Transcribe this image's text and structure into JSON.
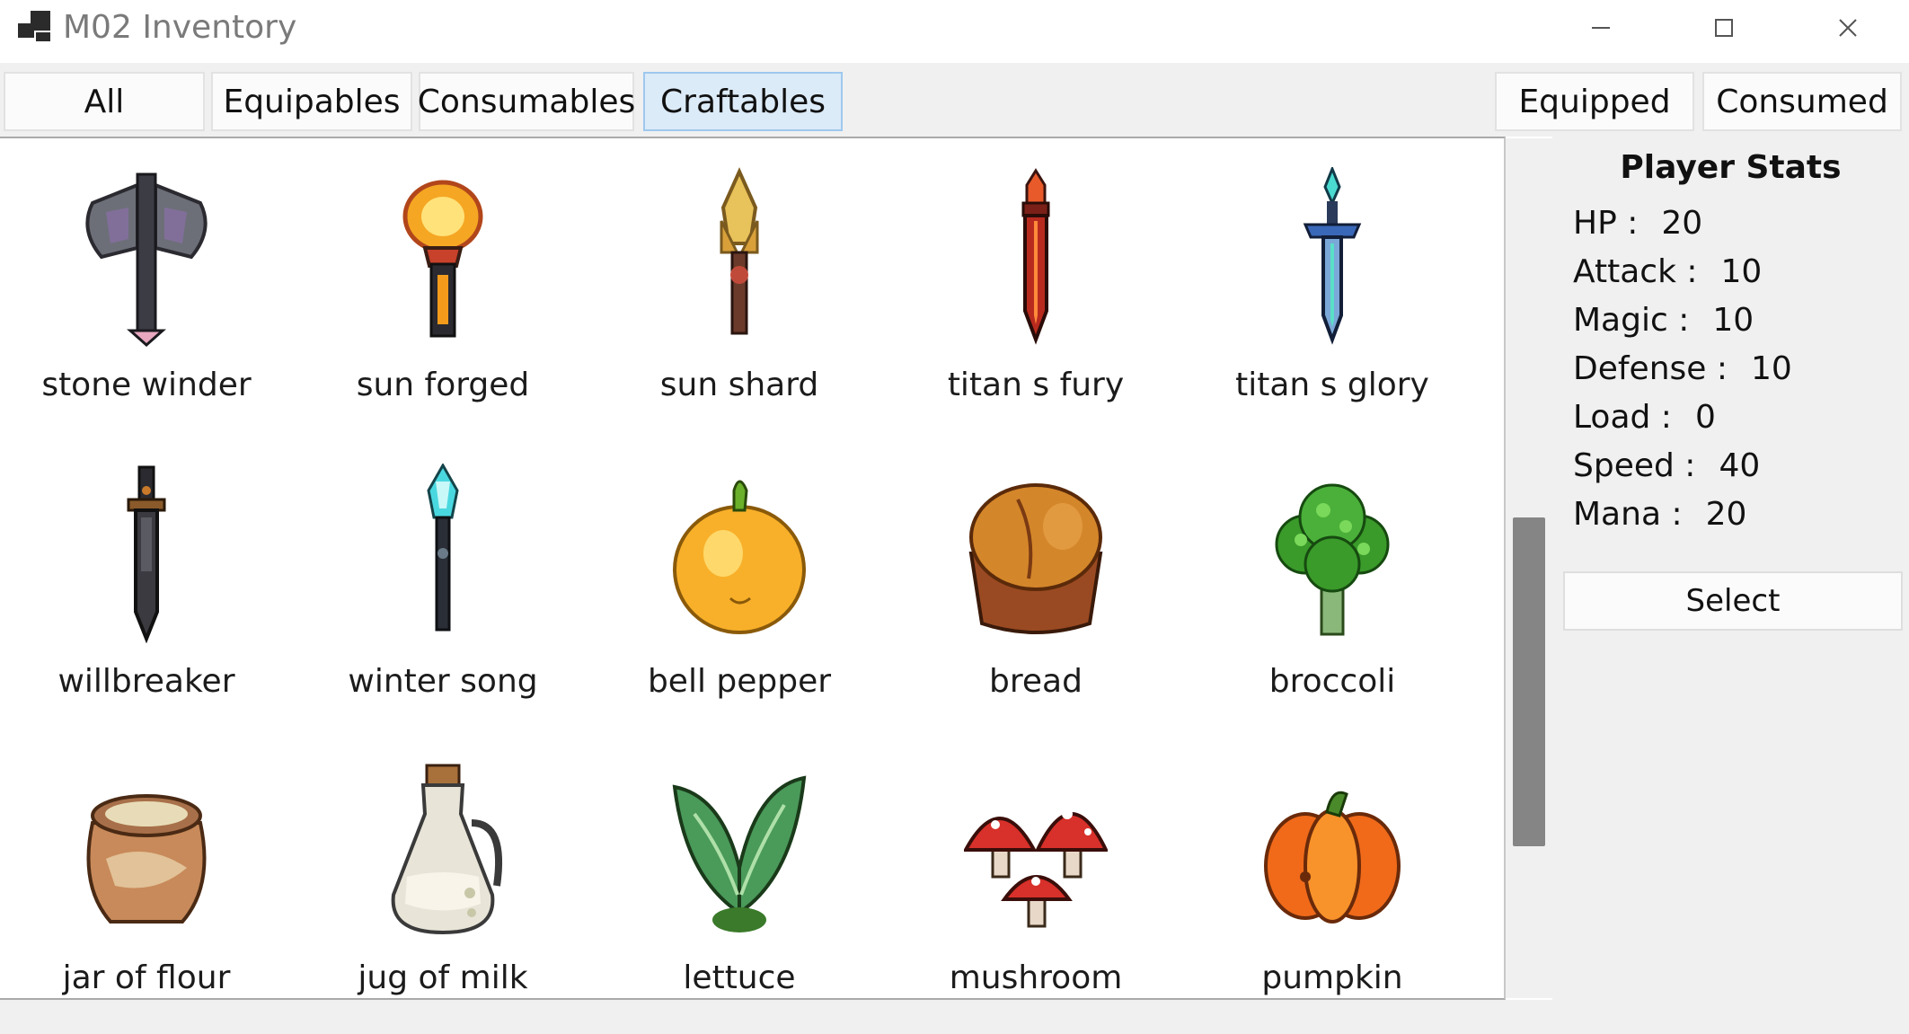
{
  "window": {
    "title": "M02 Inventory"
  },
  "tabs": [
    {
      "label": "All",
      "active": false
    },
    {
      "label": "Equipables",
      "active": false
    },
    {
      "label": "Consumables",
      "active": false
    },
    {
      "label": "Craftables",
      "active": true
    }
  ],
  "right_tabs": [
    {
      "label": "Equipped"
    },
    {
      "label": "Consumed"
    }
  ],
  "items": [
    {
      "name": "stone winder",
      "icon": "battle-axe-icon"
    },
    {
      "name": "sun forged",
      "icon": "fire-torch-icon"
    },
    {
      "name": "sun shard",
      "icon": "crystal-torch-icon"
    },
    {
      "name": "titan s fury",
      "icon": "red-sword-icon"
    },
    {
      "name": "titan s glory",
      "icon": "blue-sword-icon"
    },
    {
      "name": "willbreaker",
      "icon": "dark-sword-icon"
    },
    {
      "name": "winter song",
      "icon": "ice-staff-icon"
    },
    {
      "name": "bell pepper",
      "icon": "bell-pepper-icon"
    },
    {
      "name": "bread",
      "icon": "bread-icon"
    },
    {
      "name": "broccoli",
      "icon": "broccoli-icon"
    },
    {
      "name": "jar of flour",
      "icon": "flour-jar-icon"
    },
    {
      "name": "jug of milk",
      "icon": "milk-jug-icon"
    },
    {
      "name": "lettuce",
      "icon": "lettuce-icon"
    },
    {
      "name": "mushroom",
      "icon": "mushroom-icon"
    },
    {
      "name": "pumpkin",
      "icon": "pumpkin-icon"
    }
  ],
  "player_stats": {
    "title": "Player Stats",
    "stats": [
      {
        "label": "HP :",
        "value": "20"
      },
      {
        "label": "Attack :",
        "value": "10"
      },
      {
        "label": "Magic :",
        "value": "10"
      },
      {
        "label": "Defense :",
        "value": "10"
      },
      {
        "label": "Load :",
        "value": "0"
      },
      {
        "label": "Speed :",
        "value": "40"
      },
      {
        "label": "Mana :",
        "value": "20"
      }
    ]
  },
  "select_button": "Select",
  "colors": {
    "active_tab": "#dcebf8",
    "active_tab_border": "#9ec8ee",
    "panel_bg": "#f0f0f0",
    "scroll_thumb": "#858585"
  }
}
